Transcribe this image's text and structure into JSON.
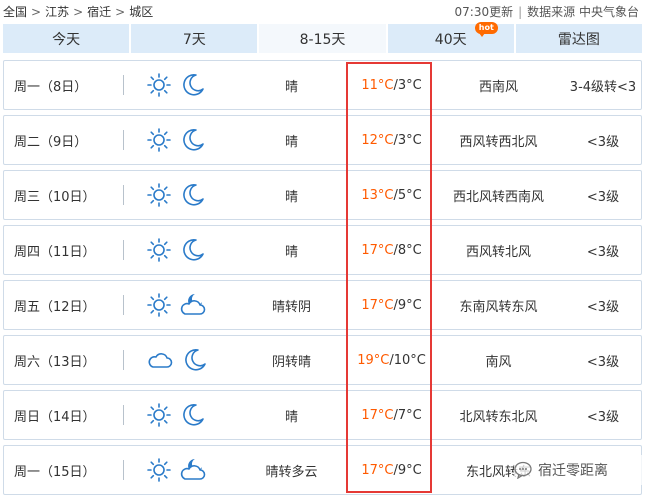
{
  "breadcrumb": {
    "items": [
      "全国",
      "江苏",
      "宿迁",
      "城区"
    ],
    "sep": ">"
  },
  "meta": {
    "update_time": "07:30更新",
    "source": "数据来源 中央气象台"
  },
  "tabs": [
    {
      "label": "今天"
    },
    {
      "label": "7天"
    },
    {
      "label": "8-15天",
      "active": true
    },
    {
      "label": "40天",
      "badge": "hot"
    },
    {
      "label": "雷达图"
    }
  ],
  "forecast": [
    {
      "day": "周一（8日）",
      "day_icon": "sun-icon",
      "night_icon": "moon-icon",
      "desc": "晴",
      "high": "11°C",
      "low": "/3°C",
      "wind": "西南风",
      "level": "3-4级转<3"
    },
    {
      "day": "周二（9日）",
      "day_icon": "sun-icon",
      "night_icon": "moon-icon",
      "desc": "晴",
      "high": "12°C",
      "low": "/3°C",
      "wind": "西风转西北风",
      "level": "<3级"
    },
    {
      "day": "周三（10日）",
      "day_icon": "sun-icon",
      "night_icon": "moon-icon",
      "desc": "晴",
      "high": "13°C",
      "low": "/5°C",
      "wind": "西北风转西南风",
      "level": "<3级"
    },
    {
      "day": "周四（11日）",
      "day_icon": "sun-icon",
      "night_icon": "moon-icon",
      "desc": "晴",
      "high": "17°C",
      "low": "/8°C",
      "wind": "西风转北风",
      "level": "<3级"
    },
    {
      "day": "周五（12日）",
      "day_icon": "sun-icon",
      "night_icon": "cloudy-moon-icon",
      "desc": "晴转阴",
      "high": "17°C",
      "low": "/9°C",
      "wind": "东南风转东风",
      "level": "<3级"
    },
    {
      "day": "周六（13日）",
      "day_icon": "cloud-icon",
      "night_icon": "moon-icon",
      "desc": "阴转晴",
      "high": "19°C",
      "low": "/10°C",
      "wind": "南风",
      "level": "<3级"
    },
    {
      "day": "周日（14日）",
      "day_icon": "sun-icon",
      "night_icon": "moon-icon",
      "desc": "晴",
      "high": "17°C",
      "low": "/7°C",
      "wind": "北风转东北风",
      "level": "<3级"
    },
    {
      "day": "周一（15日）",
      "day_icon": "sun-icon",
      "night_icon": "cloudy-moon-icon",
      "desc": "晴转多云",
      "high": "17°C",
      "low": "/9°C",
      "wind": "东北风转东",
      "level": ""
    }
  ],
  "watermark": {
    "text": "宿迁零距离"
  },
  "colors": {
    "tab_bg": "#dcebf9",
    "tab_active_bg": "#f4f8fc",
    "icon_blue": "#2b7bc9",
    "temp_high": "#ff5a00",
    "highlight_border": "#e53935",
    "hot_badge": "#ff6a00"
  }
}
